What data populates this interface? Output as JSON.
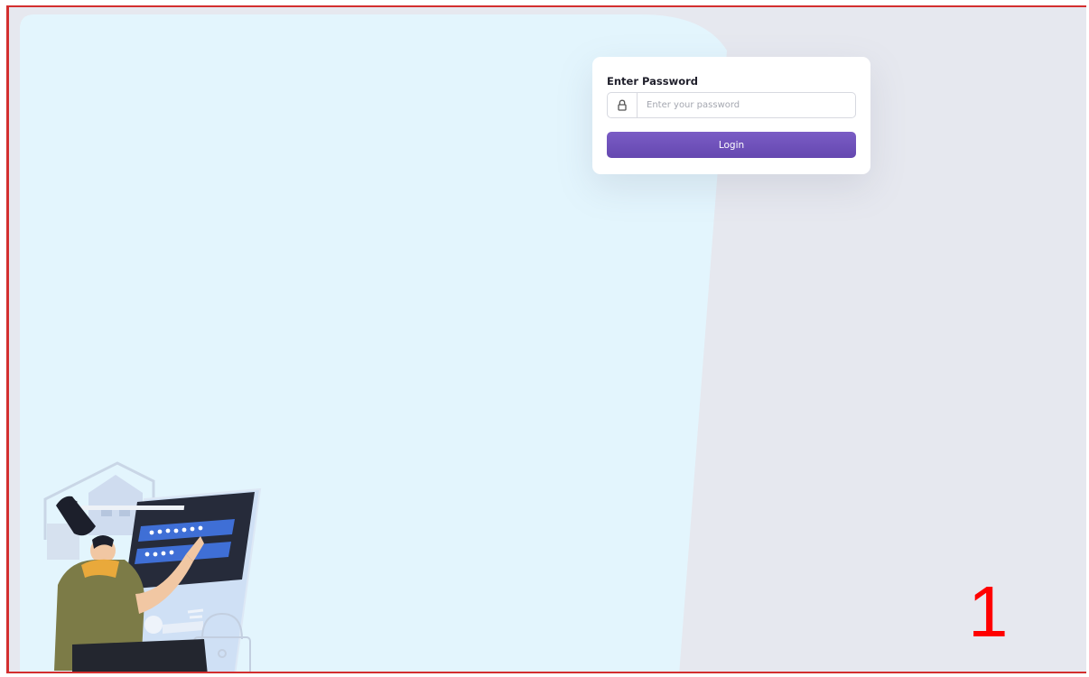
{
  "login_form": {
    "title": "Enter Password",
    "password_placeholder": "Enter your password",
    "password_value": "",
    "lock_icon": "lock-icon",
    "login_label": "Login"
  },
  "annotation": {
    "step_number": "1"
  },
  "colors": {
    "accent": "#6a4fb6",
    "panel_light_blue": "#e3f5fd",
    "background_gray": "#e6e8ef",
    "frame_red": "#d32f2f",
    "step_red": "#ff0000"
  }
}
